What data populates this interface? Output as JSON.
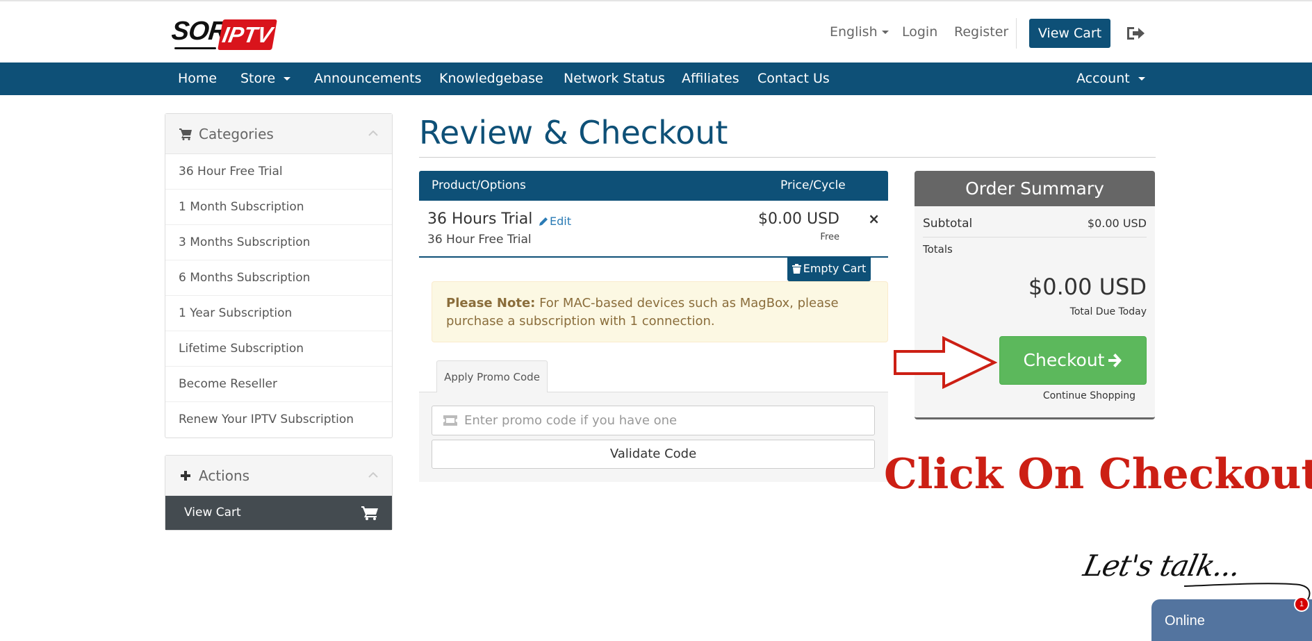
{
  "brand": {
    "logo_text_1": "SORA",
    "logo_text_2": "IPTV"
  },
  "topbar": {
    "language": "English",
    "login": "Login",
    "register": "Register",
    "view_cart": "View Cart"
  },
  "nav": {
    "home": "Home",
    "store": "Store",
    "announcements": "Announcements",
    "knowledgebase": "Knowledgebase",
    "network_status": "Network Status",
    "affiliates": "Affiliates",
    "contact_us": "Contact Us",
    "account": "Account"
  },
  "sidebar": {
    "categories_title": "Categories",
    "categories": [
      "36 Hour Free Trial",
      "1 Month Subscription",
      "3 Months Subscription",
      "6 Months Subscription",
      "1 Year Subscription",
      "Lifetime Subscription",
      "Become Reseller",
      "Renew Your IPTV Subscription"
    ],
    "actions_title": "Actions",
    "actions": [
      "View Cart"
    ]
  },
  "main": {
    "title": "Review & Checkout",
    "table_headers": [
      "Product/Options",
      "Price/Cycle"
    ],
    "item": {
      "name": "36 Hours Trial",
      "edit": "Edit",
      "group": "36 Hour Free Trial",
      "price": "$0.00 USD",
      "cycle": "Free",
      "remove": "×"
    },
    "empty_cart": "Empty Cart",
    "note_label": "Please Note:",
    "note_text": " For MAC-based devices such as MagBox, please purchase a subscription with 1 connection.",
    "promo_tab": "Apply Promo Code",
    "promo_placeholder": "Enter promo code if you have one",
    "validate": "Validate Code"
  },
  "summary": {
    "title": "Order Summary",
    "subtotal_label": "Subtotal",
    "subtotal_value": "$0.00 USD",
    "totals_label": "Totals",
    "total_amount": "$0.00 USD",
    "total_due_label": "Total Due Today",
    "checkout": "Checkout",
    "continue": "Continue Shopping"
  },
  "annotation": {
    "text": "Click On Checkout",
    "color": "#cc1f14"
  },
  "chat": {
    "lets_talk": "Let's talk...",
    "status": "Online",
    "badge": "1"
  },
  "colors": {
    "primary": "#0e5077",
    "success": "#5cb85c",
    "summary_head": "#666666",
    "note_bg": "#fcf8e3",
    "chat": "#53749f"
  }
}
